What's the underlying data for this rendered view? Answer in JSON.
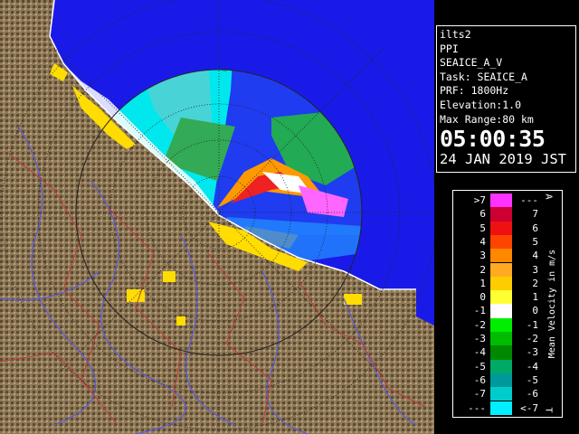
{
  "map": {
    "grid_color": "#222222"
  },
  "info": {
    "site": "ilts2",
    "product": "PPI",
    "scan": "SEAICE_A_V",
    "task": "Task: SEAICE_A",
    "prf": "PRF: 1800Hz",
    "elevation": "Elevation:1.0",
    "max_range": "Max Range:80 km",
    "time": "05:00:35",
    "date": "24 JAN 2019 JST"
  },
  "legend": {
    "title": "Mean Velocity in m/s",
    "top_marker": "A",
    "bottom_marker": "T",
    "rows": [
      {
        "lo": ">7",
        "hi": "---",
        "color": "#ff33ff"
      },
      {
        "lo": "6",
        "hi": "7",
        "color": "#cc0033"
      },
      {
        "lo": "5",
        "hi": "6",
        "color": "#ee1111"
      },
      {
        "lo": "4",
        "hi": "5",
        "color": "#ff4400"
      },
      {
        "lo": "3",
        "hi": "4",
        "color": "#ff8800"
      },
      {
        "lo": "2",
        "hi": "3",
        "color": "#ffaa22"
      },
      {
        "lo": "1",
        "hi": "2",
        "color": "#ffcc00"
      },
      {
        "lo": "0",
        "hi": "1",
        "color": "#ffff33"
      },
      {
        "lo": "-1",
        "hi": "0",
        "color": "#ffffff"
      },
      {
        "lo": "-2",
        "hi": "-1",
        "color": "#00ee00"
      },
      {
        "lo": "-3",
        "hi": "-2",
        "color": "#00bb00"
      },
      {
        "lo": "-4",
        "hi": "-3",
        "color": "#008800"
      },
      {
        "lo": "-5",
        "hi": "-4",
        "color": "#00aa66"
      },
      {
        "lo": "-6",
        "hi": "-5",
        "color": "#009999"
      },
      {
        "lo": "-7",
        "hi": "-6",
        "color": "#00cccc"
      },
      {
        "lo": "---",
        "hi": "<-7",
        "color": "#00eeff"
      }
    ]
  },
  "colors": {
    "sea": "#1a1ae8",
    "terrain": "#8a7454",
    "river": "#5a5adc",
    "border": "#c03a3a",
    "coast": "#ffffff"
  }
}
